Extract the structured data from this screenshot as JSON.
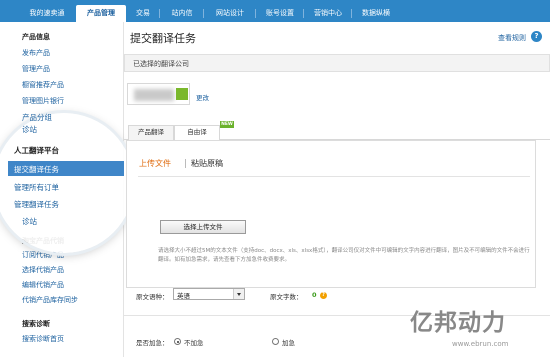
{
  "nav": {
    "tabs": [
      "我的速卖通",
      "产品管理",
      "交易",
      "站内信",
      "网站设计",
      "账号设置",
      "营销中心",
      "数据纵横"
    ],
    "active_index": 1
  },
  "sidebar": {
    "section1_title": "产品信息",
    "section1_items": [
      "发布产品",
      "管理产品",
      "橱窗推荐产品",
      "管理图片银行",
      "产品分组",
      "诊站"
    ],
    "section2_title": "人工翻译平台",
    "section2_items": [
      "提交翻译任务",
      "管理所有订单",
      "管理翻译任务",
      "诊站"
    ],
    "section3_title": "淘宝产品代销",
    "section3_items": [
      "订阅代销产品",
      "选择代销产品",
      "编辑代销产品",
      "代销产品库存同步"
    ],
    "section4_title": "搜索诊断",
    "section4_items": [
      "搜索诊断首页"
    ],
    "active_label": "提交翻译任务"
  },
  "main": {
    "title": "提交翻译任务",
    "help_link": "查看规则",
    "help_icon": "?",
    "company_label": "已选择的翻译公司",
    "change_link": "更改",
    "tabs": [
      "产品翻译",
      "自由译"
    ],
    "new_badge": "NEW",
    "upload_tab": "上传文件",
    "paste_tab": "粘贴原稿",
    "choose_button": "选择上传文件",
    "hint": "请选择大小不超过5M的文本文件（支持doc、docx、xls、xlsx格式），翻译公司仅对文件中可编辑的文字内容进行翻译，图片及不可编辑的文件不会进行翻译。如有加急需求，请先查看下方加急件收费要求。",
    "source_lang_label": "原文语种：",
    "source_lang_value": "英语",
    "word_count_label": "原文字数：",
    "word_count_value": "0",
    "urgent_label": "是否加急：",
    "not_urgent": "不加急",
    "urgent": "加急"
  },
  "watermark": {
    "brand": "亿邦动力",
    "url": "www.ebrun.com"
  }
}
